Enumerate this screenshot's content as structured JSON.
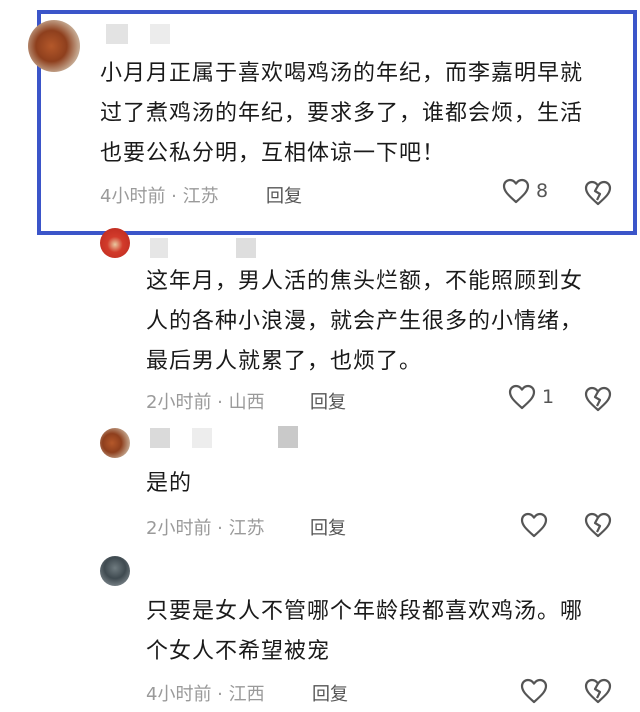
{
  "comments": [
    {
      "lines": [
        "小月月正属于喜欢喝鸡汤的年纪，而李嘉明早就",
        "过了煮鸡汤的年纪，要求多了，谁都会烦，生活",
        "也要公私分明，互相体谅一下吧！"
      ],
      "meta": "4小时前 · 江苏",
      "reply": "回复",
      "likes": "8"
    },
    {
      "lines": [
        "这年月，男人活的焦头烂额，不能照顾到女",
        "人的各种小浪漫，就会产生很多的小情绪，",
        "最后男人就累了，也烦了。"
      ],
      "meta": "2小时前 · 山西",
      "reply": "回复",
      "likes": "1"
    },
    {
      "lines": [
        "是的"
      ],
      "meta": "2小时前 · 江苏",
      "reply": "回复",
      "likes": ""
    },
    {
      "lines": [
        "只要是女人不管哪个年龄段都喜欢鸡汤。哪",
        "个女人不希望被宠"
      ],
      "meta": "4小时前 · 江西",
      "reply": "回复",
      "likes": ""
    }
  ],
  "colors": {
    "highlight": "#3b55c9",
    "meta": "#9a9a9a"
  },
  "icons": {
    "like": "heart-outline-icon",
    "dislike": "broken-heart-icon"
  }
}
